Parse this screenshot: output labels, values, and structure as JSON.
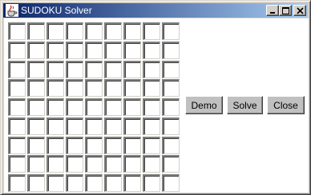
{
  "window": {
    "title": "SUDOKU Solver",
    "controls": [
      "minimize-icon",
      "maximize-icon",
      "close-icon"
    ],
    "title_gradient": [
      "#0a246a",
      "#a6caf0"
    ]
  },
  "grid": {
    "rows": 9,
    "cols": 9,
    "cells": [
      [
        "",
        "",
        "",
        "",
        "",
        "",
        "",
        "",
        ""
      ],
      [
        "",
        "",
        "",
        "",
        "",
        "",
        "",
        "",
        ""
      ],
      [
        "",
        "",
        "",
        "",
        "",
        "",
        "",
        "",
        ""
      ],
      [
        "",
        "",
        "",
        "",
        "",
        "",
        "",
        "",
        ""
      ],
      [
        "",
        "",
        "",
        "",
        "",
        "",
        "",
        "",
        ""
      ],
      [
        "",
        "",
        "",
        "",
        "",
        "",
        "",
        "",
        ""
      ],
      [
        "",
        "",
        "",
        "",
        "",
        "",
        "",
        "",
        ""
      ],
      [
        "",
        "",
        "",
        "",
        "",
        "",
        "",
        "",
        ""
      ],
      [
        "",
        "",
        "",
        "",
        "",
        "",
        "",
        "",
        ""
      ]
    ]
  },
  "buttons": {
    "demo": "Demo",
    "solve": "Solve",
    "close": "Close"
  }
}
